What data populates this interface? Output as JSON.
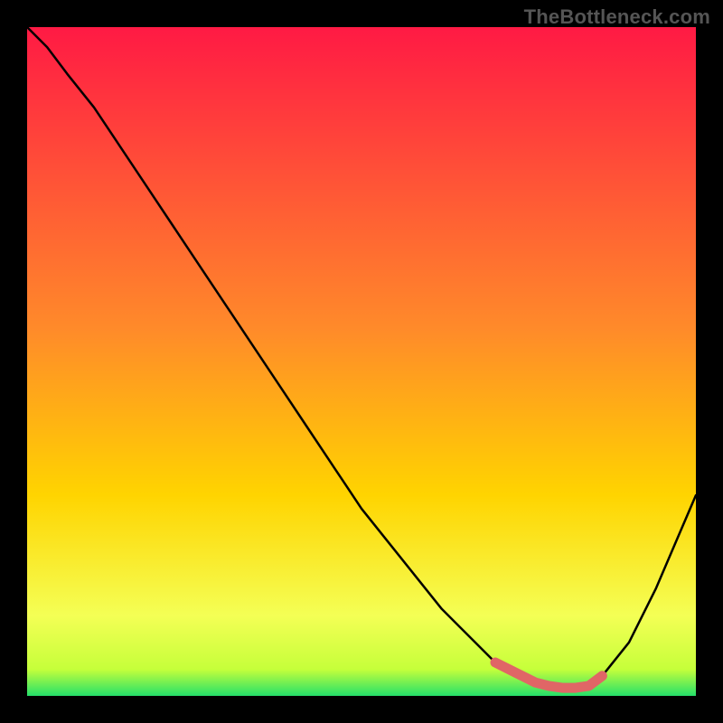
{
  "watermark": "TheBottleneck.com",
  "colors": {
    "bg": "#000000",
    "grad_top": "#ff1a44",
    "grad_mid": "#ffd400",
    "grad_bot": "#25e06a",
    "curve": "#000000",
    "highlight": "#e06666"
  },
  "chart_data": {
    "type": "line",
    "title": "",
    "xlabel": "",
    "ylabel": "",
    "xlim": [
      0,
      100
    ],
    "ylim": [
      0,
      100
    ],
    "grid": false,
    "legend": false,
    "annotations": [],
    "x": [
      0,
      3,
      6,
      10,
      14,
      18,
      22,
      26,
      30,
      34,
      38,
      42,
      46,
      50,
      54,
      58,
      62,
      66,
      70,
      72,
      74,
      76,
      78,
      80,
      82,
      84,
      86,
      90,
      94,
      97,
      100
    ],
    "values": [
      100,
      97,
      93,
      88,
      82,
      76,
      70,
      64,
      58,
      52,
      46,
      40,
      34,
      28,
      23,
      18,
      13,
      9,
      5,
      4,
      3,
      2,
      1.5,
      1.2,
      1.2,
      1.5,
      3,
      8,
      16,
      23,
      30
    ],
    "highlight_range_x": [
      70,
      86
    ],
    "highlight_note": "flat minimum region emphasized with thick pink stroke"
  }
}
